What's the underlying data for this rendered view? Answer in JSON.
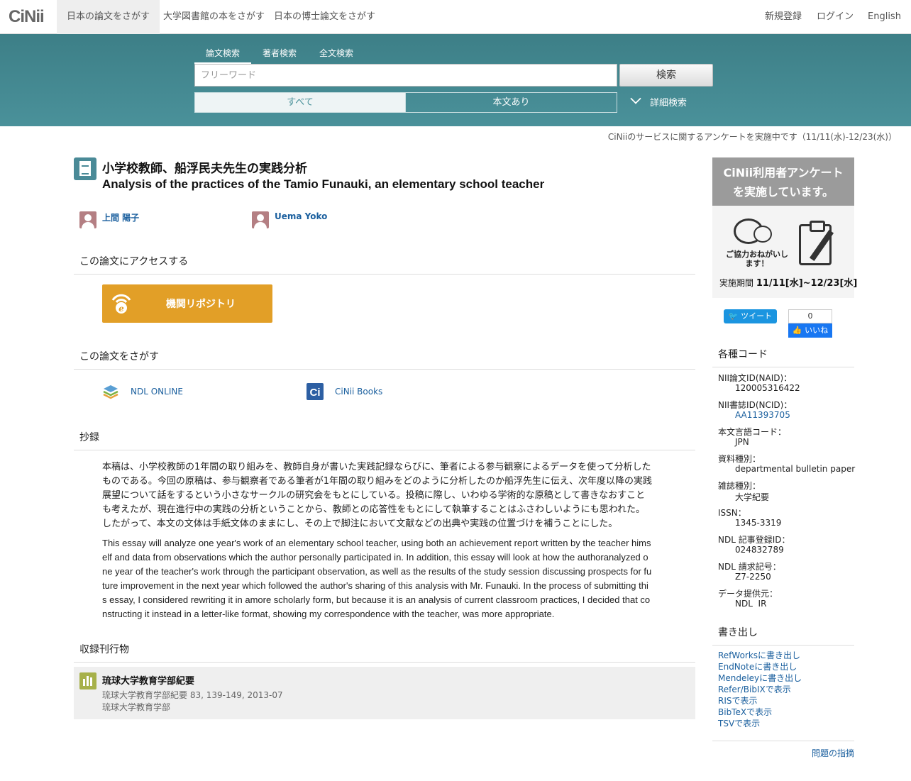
{
  "header": {
    "logo": "CiNii",
    "tabs": [
      "日本の論文をさがす",
      "大学図書館の本をさがす",
      "日本の博士論文をさがす"
    ],
    "right": [
      "新規登録",
      "ログイン",
      "English"
    ]
  },
  "search": {
    "tabs": [
      "論文検索",
      "著者検索",
      "全文検索"
    ],
    "placeholder": "フリーワード",
    "button": "検索",
    "filters": [
      "すべて",
      "本文あり"
    ],
    "advanced": "詳細検索"
  },
  "notice": "CiNiiのサービスに関するアンケートを実施中です（11/11(水)-12/23(水)）",
  "article": {
    "title_ja": "小学校教師、船浮民夫先生の実践分析",
    "title_en": "Analysis of the practices of the Tamio Funauki, an elementary school teacher",
    "authors": [
      "上間 陽子",
      "Uema Yoko"
    ],
    "access_heading": "この論文にアクセスする",
    "repo_button": "機関リポジトリ",
    "find_heading": "この論文をさがす",
    "find_links": [
      "NDL ONLINE",
      "CiNii Books"
    ],
    "abstract_heading": "抄録",
    "abstract_ja": "本稿は、小学校教師の1年間の取り組みを、教師自身が書いた実践記録ならびに、筆者による参与観察によるデータを使って分析したものである。今回の原稿は、参与観察者である筆者が1年間の取り組みをどのように分析したのか船浮先生に伝え、次年度以降の実践展望について話をするという小さなサークルの研究会をもとにしている。投稿に際し、いわゆる学術的な原稿として書きなおすことも考えたが、現在進行中の実践の分析ということから、教師との応答性をもとにして執筆することはふさわしいようにも思われた。したがって、本文の文体は手紙文体のままにし、その上で脚注において文献などの出典や実践の位置づけを補うことにした。",
    "abstract_en": "This essay will analyze one year's work of an elementary school teacher, using both an achievement report written by the teacher himself and data from observations which the author personally participated in. In addition, this essay will look at how the authoranalyzed one year of the teacher's work through the participant observation, as well as the results of the study session discussing prospects for future improvement in the next year which followed the author's sharing of this analysis with Mr. Funauki. In the process of submitting this essay, I considered rewriting it in amore scholarly form, but because it is an analysis of current classroom practices, I decided that constructing it instead in a letter-like format, showing my correspondence with the teacher, was more appropriate.",
    "journal_heading": "収録刊行物",
    "journal": {
      "title": "琉球大学教育学部紀要",
      "citation": "琉球大学教育学部紀要 83, 139-149, 2013-07",
      "publisher": "琉球大学教育学部"
    }
  },
  "sidebar": {
    "banner_title_1": "CiNii利用者アンケート",
    "banner_title_2": "を実施しています。",
    "banner_msg": "ご協力おねがいします！",
    "banner_period_label": "実施期間",
    "banner_period": "11/11[水]~12/23[水]",
    "tweet": "ツイート",
    "fb_count": "0",
    "fb_like": "いいね",
    "codes_heading": "各種コード",
    "codes": [
      {
        "label": "NII論文ID(NAID)：",
        "value": "120005316422",
        "link": false
      },
      {
        "label": "NII書誌ID(NCID)：",
        "value": "AA11393705",
        "link": true
      },
      {
        "label": "本文言語コード：",
        "value": "JPN",
        "link": false
      },
      {
        "label": "資料種別：",
        "value": "departmental bulletin paper",
        "link": false
      },
      {
        "label": "雑誌種別：",
        "value": "大学紀要",
        "link": false
      },
      {
        "label": "ISSN：",
        "value": "1345-3319",
        "link": false
      },
      {
        "label": "NDL 記事登録ID：",
        "value": "024832789",
        "link": false
      },
      {
        "label": "NDL 請求記号：",
        "value": "Z7-2250",
        "link": false
      },
      {
        "label": "データ提供元：",
        "value": "NDL  IR",
        "link": false
      }
    ],
    "export_heading": "書き出し",
    "exports": [
      "RefWorksに書き出し",
      "EndNoteに書き出し",
      "Mendeleyに書き出し",
      "Refer/BibIXで表示",
      "RISで表示",
      "BibTeXで表示",
      "TSVで表示"
    ],
    "report": "問題の指摘"
  },
  "colors": {
    "band": "#4a919a",
    "link": "#1a5f9e",
    "repo": "#e29f27"
  }
}
